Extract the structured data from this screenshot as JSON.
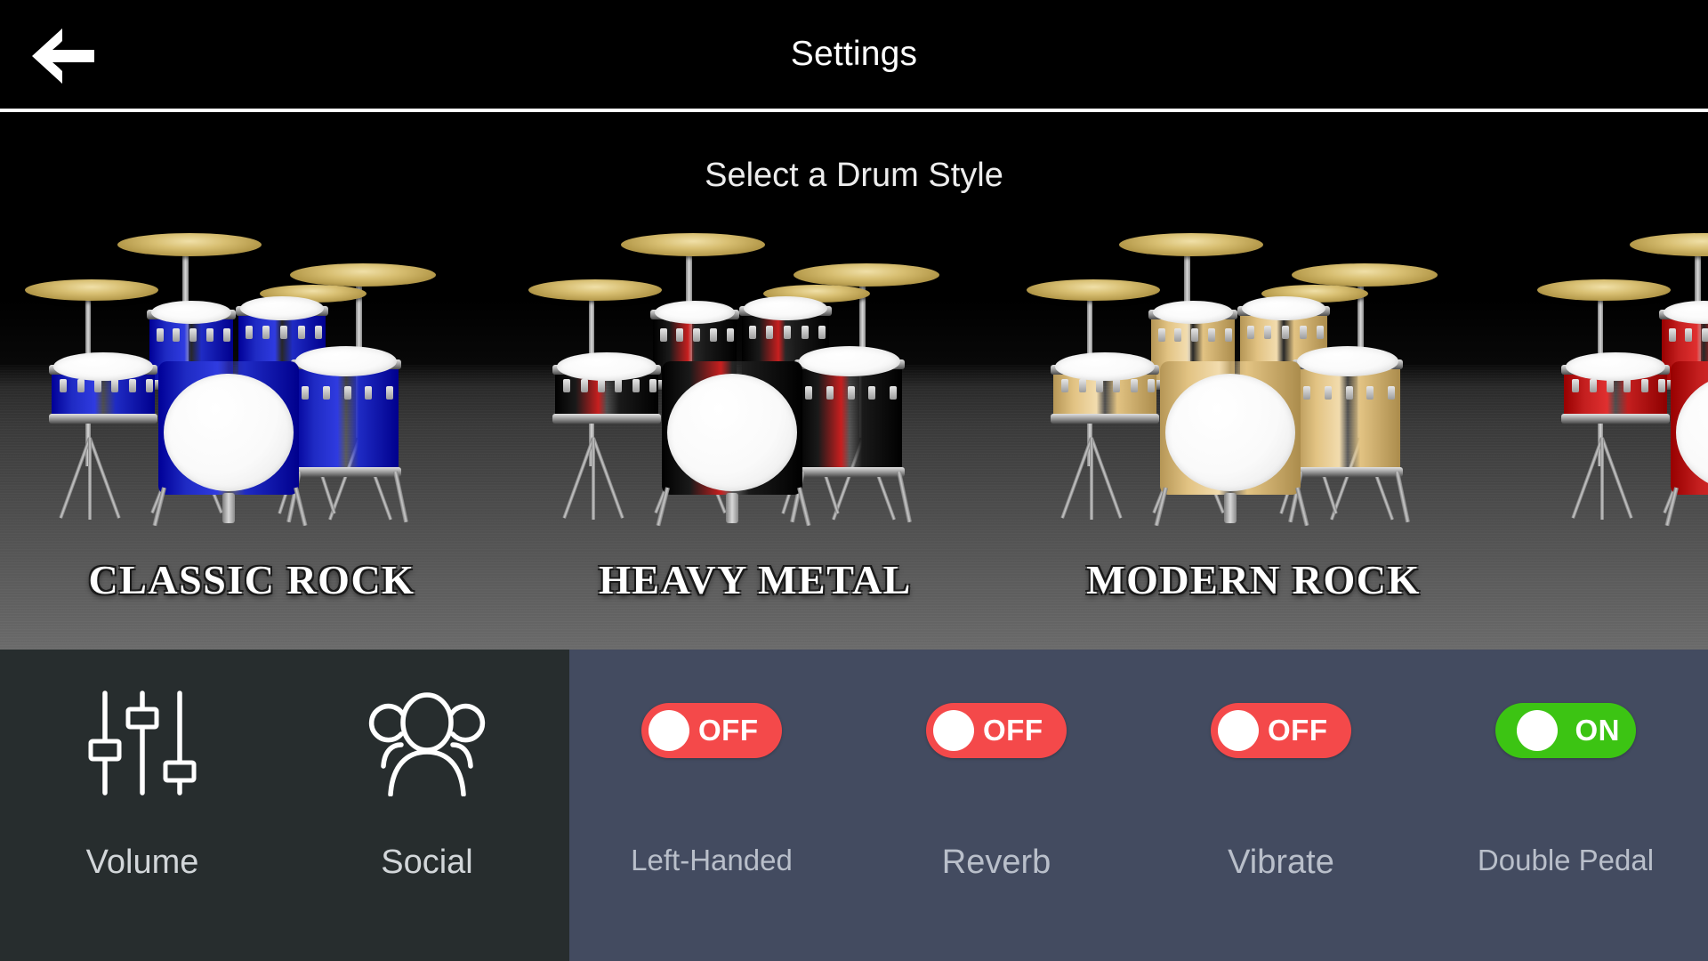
{
  "header": {
    "title": "Settings",
    "back_icon": "back-arrow-icon"
  },
  "carousel": {
    "prompt": "Select a Drum Style",
    "kits": [
      {
        "name": "CLASSIC ROCK",
        "color": "#1f2bc4",
        "accent": "#2f3be0",
        "icon": "drum-kit-icon"
      },
      {
        "name": "HEAVY METAL",
        "color": "#1a1a1a",
        "accent": "#c81f1f",
        "icon": "drum-kit-icon"
      },
      {
        "name": "MODERN ROCK",
        "color": "#e2c383",
        "accent": "#f2dcae",
        "icon": "drum-kit-icon"
      },
      {
        "name": "",
        "color": "#c41f1f",
        "accent": "#e03030",
        "icon": "drum-kit-icon"
      }
    ]
  },
  "bottom": {
    "tools": [
      {
        "label": "Volume",
        "icon": "sliders-icon"
      },
      {
        "label": "Social",
        "icon": "people-group-icon"
      }
    ],
    "toggles": [
      {
        "label": "Left-Handed",
        "state": "OFF",
        "on": false
      },
      {
        "label": "Reverb",
        "state": "OFF",
        "on": false
      },
      {
        "label": "Vibrate",
        "state": "OFF",
        "on": false
      },
      {
        "label": "Double Pedal",
        "state": "ON",
        "on": true
      }
    ]
  },
  "colors": {
    "toggle_off": "#F4494A",
    "toggle_on": "#3CC413",
    "panel_left": "#272D2E",
    "panel_right": "#434B60",
    "header_bg": "#000000",
    "label_text": "#b9bfca"
  }
}
